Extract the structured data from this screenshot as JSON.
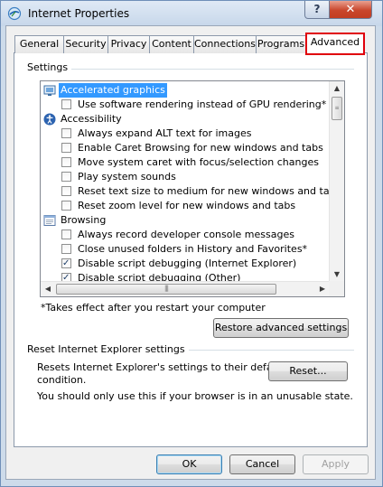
{
  "window": {
    "title": "Internet Properties",
    "help_label": "?",
    "close_label": "✕"
  },
  "tabs": [
    {
      "label": "General"
    },
    {
      "label": "Security"
    },
    {
      "label": "Privacy"
    },
    {
      "label": "Content"
    },
    {
      "label": "Connections"
    },
    {
      "label": "Programs"
    },
    {
      "label": "Advanced",
      "active": true
    }
  ],
  "settings": {
    "group_label": "Settings",
    "tree": [
      {
        "type": "category",
        "label": "Accelerated graphics",
        "selected": true,
        "icon": "monitor-icon"
      },
      {
        "type": "option",
        "label": "Use software rendering instead of GPU rendering*",
        "checked": false
      },
      {
        "type": "category",
        "label": "Accessibility",
        "icon": "accessibility-icon"
      },
      {
        "type": "option",
        "label": "Always expand ALT text for images",
        "checked": false
      },
      {
        "type": "option",
        "label": "Enable Caret Browsing for new windows and tabs",
        "checked": false
      },
      {
        "type": "option",
        "label": "Move system caret with focus/selection changes",
        "checked": false
      },
      {
        "type": "option",
        "label": "Play system sounds",
        "checked": false
      },
      {
        "type": "option",
        "label": "Reset text size to medium for new windows and tabs",
        "checked": false
      },
      {
        "type": "option",
        "label": "Reset zoom level for new windows and tabs",
        "checked": false
      },
      {
        "type": "category",
        "label": "Browsing",
        "icon": "browsing-page-icon"
      },
      {
        "type": "option",
        "label": "Always record developer console messages",
        "checked": false
      },
      {
        "type": "option",
        "label": "Close unused folders in History and Favorites*",
        "checked": false
      },
      {
        "type": "option",
        "label": "Disable script debugging (Internet Explorer)",
        "checked": true
      },
      {
        "type": "option",
        "label": "Disable script debugging (Other)",
        "checked": true
      }
    ],
    "footnote": "*Takes effect after you restart your computer",
    "restore_button": "Restore advanced settings"
  },
  "reset": {
    "group_label": "Reset Internet Explorer settings",
    "description": [
      "Resets Internet Explorer's settings to their default",
      "condition."
    ],
    "button": "Reset...",
    "warning": "You should only use this if your browser is in an unusable state."
  },
  "footer": {
    "ok": "OK",
    "cancel": "Cancel",
    "apply": "Apply"
  }
}
